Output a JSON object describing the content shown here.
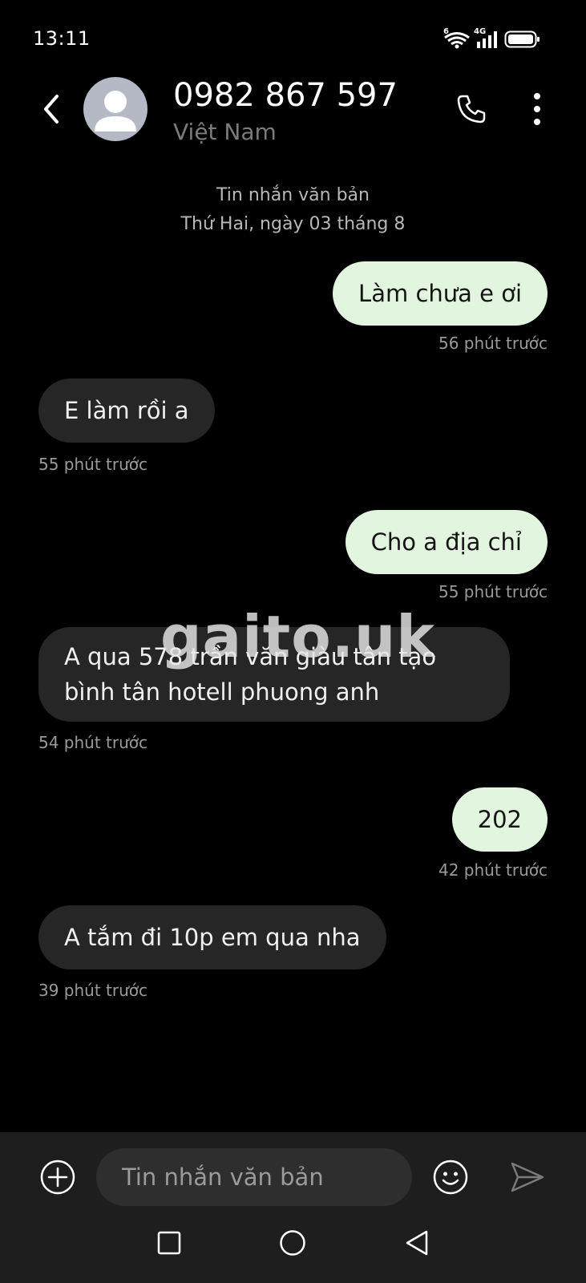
{
  "status_bar": {
    "time": "13:11",
    "network": "4G",
    "sim": "6"
  },
  "header": {
    "contact_number": "0982 867 597",
    "contact_country": "Việt Nam"
  },
  "conversation": {
    "type_label": "Tin nhắn văn bản",
    "date_label": "Thứ Hai, ngày 03 tháng 8"
  },
  "messages": [
    {
      "direction": "outgoing",
      "text": "Làm chưa e ơi",
      "time": "56 phút trước"
    },
    {
      "direction": "incoming",
      "text": "E làm rồi a",
      "time": "55 phút trước"
    },
    {
      "direction": "outgoing",
      "text": "Cho a địa chỉ",
      "time": "55 phút trước"
    },
    {
      "direction": "incoming",
      "lines": [
        "A qua 578 trần văn giàu tân tạo",
        "bình tân hotell phuong anh"
      ],
      "time": "54 phút trước"
    },
    {
      "direction": "outgoing",
      "text": "202",
      "time": "42 phút trước"
    },
    {
      "direction": "incoming",
      "text": "A tắm đi 10p em qua nha",
      "time": "39 phút trước"
    }
  ],
  "watermark": "gaito.uk",
  "compose": {
    "placeholder": "Tin nhắn văn bản"
  },
  "colors": {
    "outgoing_bubble": "#e2f6df",
    "incoming_bubble": "#262626",
    "background": "#000000",
    "bottom_bar": "#1e1e1e"
  }
}
